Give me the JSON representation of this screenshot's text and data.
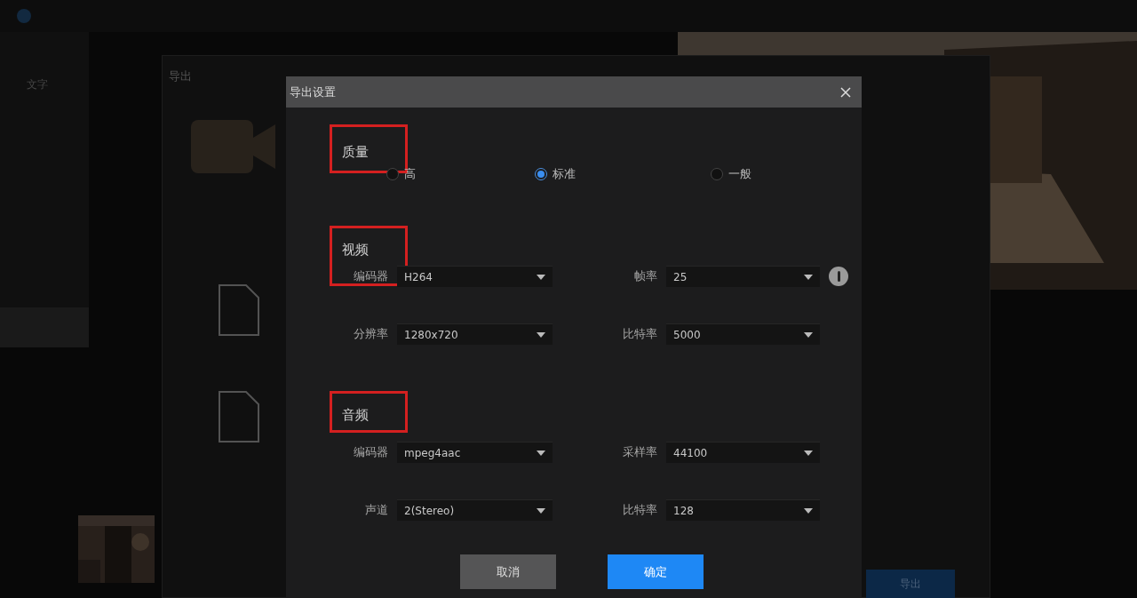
{
  "background": {
    "sidebar_items": [
      "文字"
    ],
    "export_panel_title": "导出",
    "export_button": "导出"
  },
  "dialog": {
    "title": "导出设置",
    "sections": [
      {
        "heading": "质量",
        "highlighted": true,
        "kind": "radio",
        "options": [
          {
            "label": "高",
            "selected": false
          },
          {
            "label": "标准",
            "selected": true
          },
          {
            "label": "一般",
            "selected": false
          }
        ]
      },
      {
        "heading": "视频",
        "highlighted": true,
        "kind": "fields",
        "fields": [
          {
            "label": "编码器",
            "value": "H264"
          },
          {
            "label": "帧率",
            "value": "25",
            "info": true
          },
          {
            "label": "分辨率",
            "value": "1280x720"
          },
          {
            "label": "比特率",
            "value": "5000"
          }
        ]
      },
      {
        "heading": "音频",
        "highlighted": true,
        "kind": "fields",
        "fields": [
          {
            "label": "编码器",
            "value": "mpeg4aac"
          },
          {
            "label": "采样率",
            "value": "44100"
          },
          {
            "label": "声道",
            "value": "2(Stereo)"
          },
          {
            "label": "比特率",
            "value": "128"
          }
        ]
      }
    ],
    "buttons": [
      {
        "label": "取消",
        "kind": "secondary"
      },
      {
        "label": "确定",
        "kind": "primary"
      }
    ]
  }
}
